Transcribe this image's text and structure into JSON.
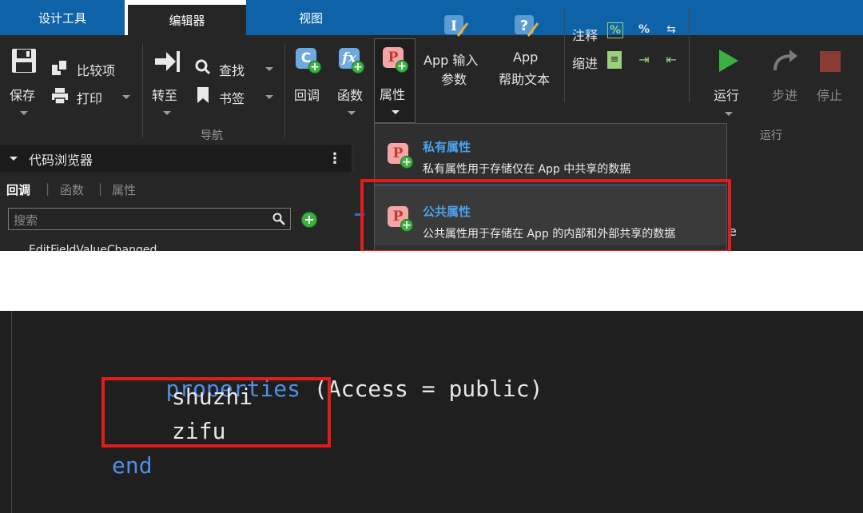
{
  "tabs": [
    "设计工具",
    "编辑器",
    "视图"
  ],
  "ribbon": {
    "save": "保存",
    "compare": "比较项",
    "print": "打印",
    "goto": "转至",
    "find": "查找",
    "bookmark": "书签",
    "nav_group": "导航",
    "callback": "回调",
    "function": "函数",
    "property": "属性",
    "app_input_line1": "App 输入",
    "app_input_line2": "参数",
    "app_help_line1": "App",
    "app_help_line2": "帮助文本",
    "comment": "注释",
    "indent": "缩进",
    "run": "运行",
    "step": "步进",
    "stop": "停止",
    "run_group": "运行"
  },
  "code_browser": {
    "title": "代码浏览器",
    "tabs": [
      "回调",
      "函数",
      "属性"
    ],
    "search_placeholder": "搜索",
    "partial_item": "EditFieldValueChanged"
  },
  "dropdown": {
    "private_title": "私有属性",
    "private_desc": "私有属性用于存储仅在 App 中共享的数据",
    "public_title": "公共属性",
    "public_desc": "公共属性用于存储在 App 的内部和外部共享的数据",
    "trailing_char": "e"
  },
  "code": {
    "kw_properties": "properties",
    "rest_line1": " (Access = public)",
    "prop1": "shuzhi",
    "prop2": "zifu",
    "kw_end": "end"
  },
  "colors": {
    "accent": "#0e63a8",
    "keyword": "#4f8fe6",
    "highlight": "#e31b1b",
    "add_green": "#3cb043"
  }
}
